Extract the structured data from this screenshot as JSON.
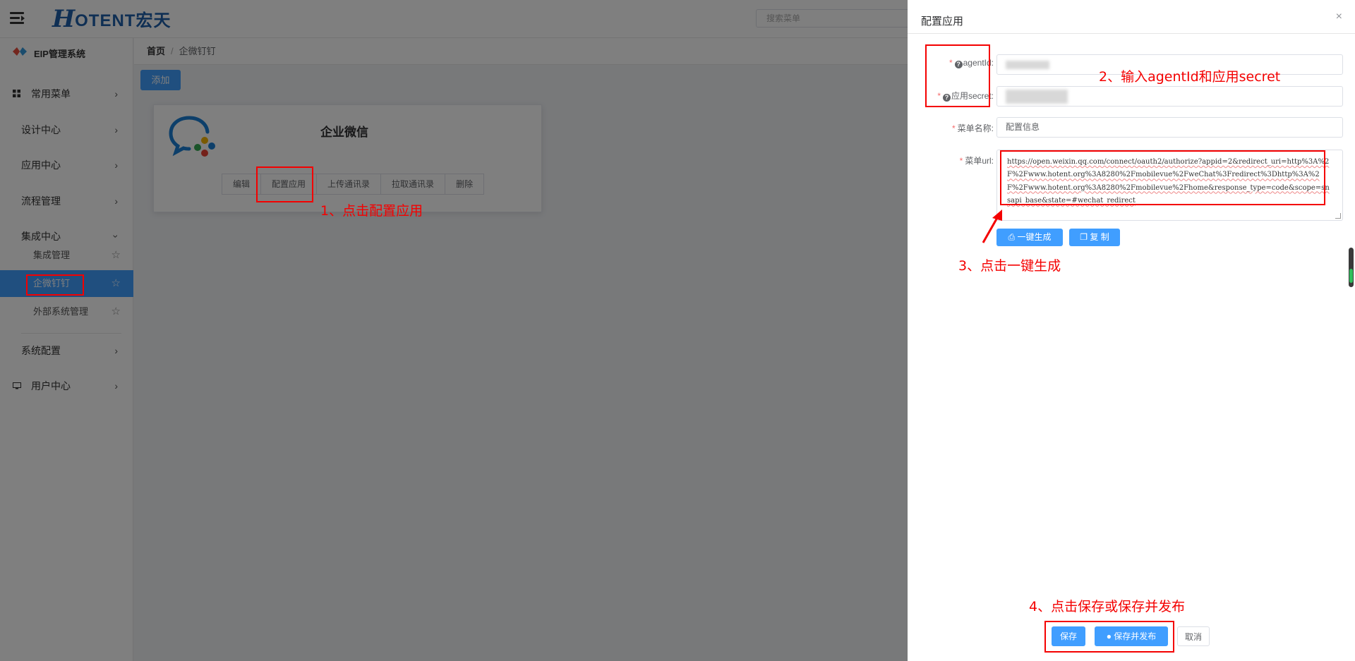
{
  "header": {
    "logo_h": "H",
    "logo_rest": "OTENT宏天",
    "search_placeholder": "搜索菜单"
  },
  "sidebar": {
    "system_title": "EIP管理系统",
    "items": [
      {
        "label": "常用菜单"
      },
      {
        "label": "设计中心"
      },
      {
        "label": "应用中心"
      },
      {
        "label": "流程管理"
      },
      {
        "label": "集成中心"
      },
      {
        "label": "系统配置"
      },
      {
        "label": "用户中心"
      }
    ],
    "sub_items": [
      {
        "label": "集成管理"
      },
      {
        "label": "企微钉钉"
      },
      {
        "label": "外部系统管理"
      }
    ]
  },
  "breadcrumb": {
    "home": "首页",
    "separator": "/",
    "current": "企微钉钉"
  },
  "toolbar": {
    "add_label": "添加"
  },
  "card": {
    "title": "企业微信",
    "buttons": [
      "编辑",
      "配置应用",
      "上传通讯录",
      "拉取通讯录",
      "删除"
    ]
  },
  "drawer": {
    "title": "配置应用",
    "close": "×",
    "form": {
      "agentid_label": "agentId:",
      "secret_label": "应用secret:",
      "menu_name_label": "菜单名称:",
      "menu_name_value": "配置信息",
      "menu_url_label": "菜单url:",
      "menu_url_value": "https://open.weixin.qq.com/connect/oauth2/authorize?appid=2&redirect_uri=http%3A%2F%2Fwww.hotent.org%3A8280%2Fmobilevue%2FweChat%3Fredirect%3Dhttp%3A%2F%2Fwww.hotent.org%3A8280%2Fmobilevue%2Fhome&response_type=code&scope=snsapi_base&state=#wechat_redirect",
      "generate_label": "一键生成",
      "copy_label": "复 制"
    },
    "footer": {
      "save": "保存",
      "save_publish": "保存并发布",
      "cancel": "取消"
    }
  },
  "annotations": {
    "step1": "1、点击配置应用",
    "step2": "2、输入agentId和应用secret",
    "step3": "3、点击一键生成",
    "step4": "4、点击保存或保存并发布",
    "color": "#f40000"
  },
  "colors": {
    "primary": "#409eff",
    "overlay": "rgba(0,0,0,0.5)",
    "logo": "#1f5fa8"
  }
}
